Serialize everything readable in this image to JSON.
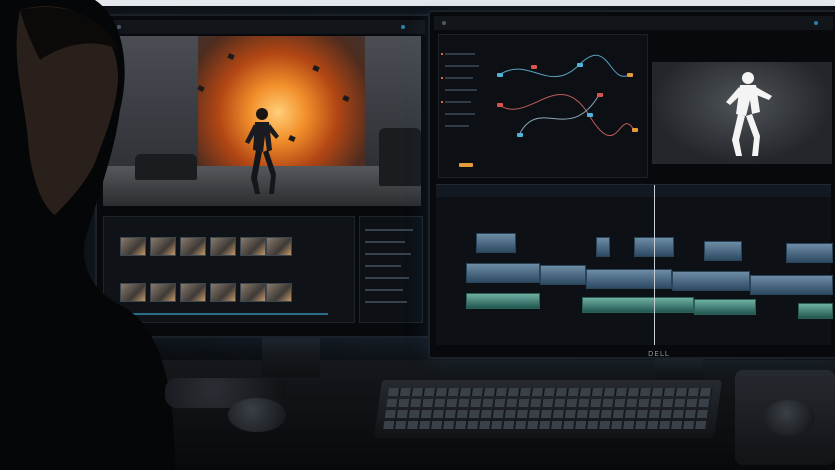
{
  "photo": {
    "subject": "video-editing-workstation",
    "icons": [
      "person-silhouette",
      "monitor-icon",
      "keyboard-icon",
      "mouse-icon"
    ],
    "colors": {
      "explosion": "#f2902b",
      "ui_accent": "#4fb3d9",
      "mask_white": "#f4f4f4",
      "clip_blue": "#2d4a63",
      "clip_teal": "#22574f"
    }
  },
  "right_monitor": {
    "brand_label": "DELL"
  }
}
